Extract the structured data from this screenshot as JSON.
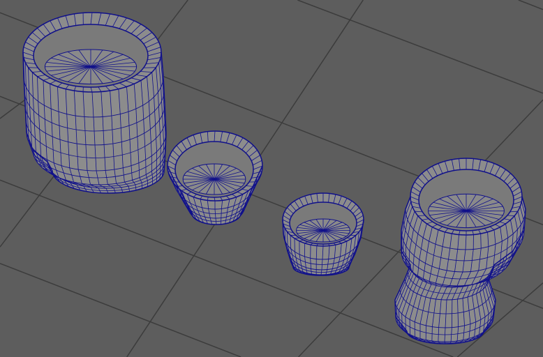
{
  "viewport": {
    "background": "#5d5d5d",
    "grid_color": "#3c3c3c",
    "surface_color": "#8c8c8c",
    "interior_color": "#7a7a7a",
    "wire_color": "#10108a"
  }
}
